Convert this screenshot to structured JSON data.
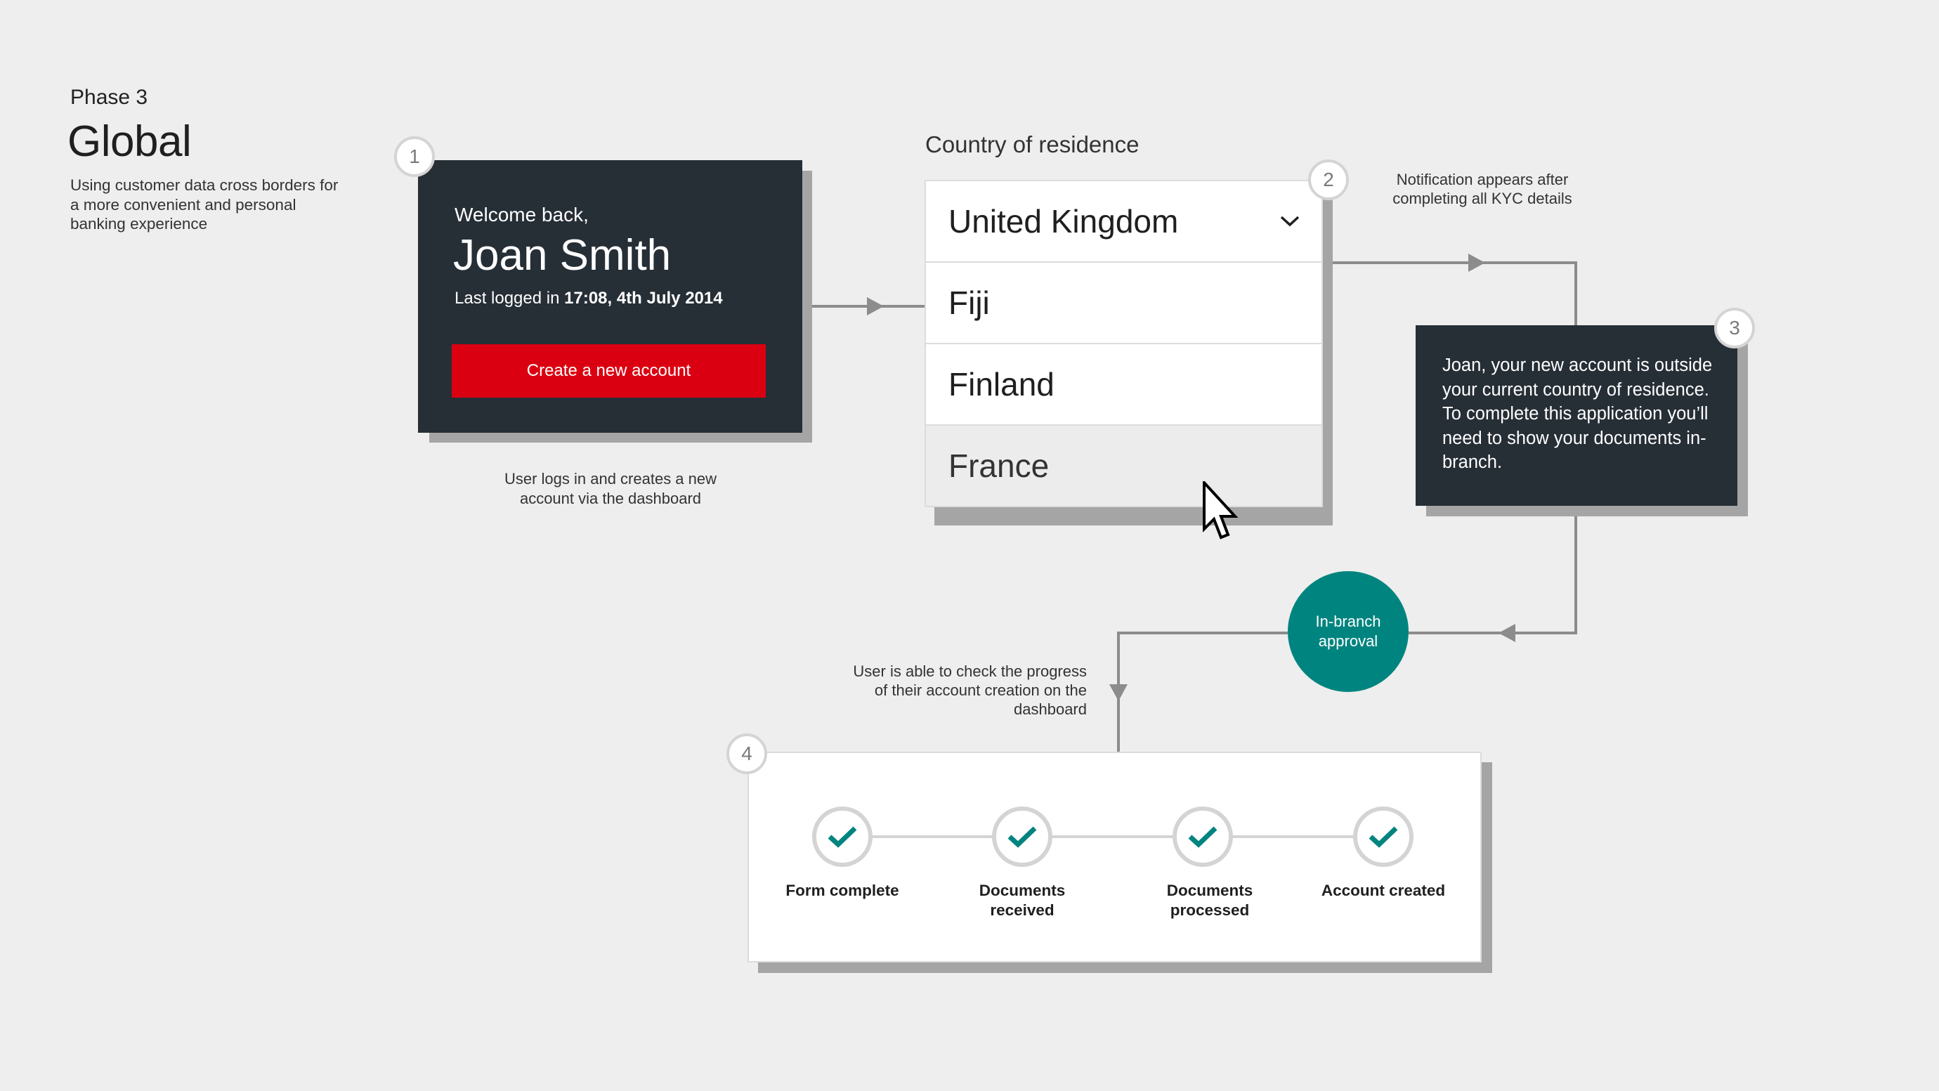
{
  "header": {
    "phase": "Phase 3",
    "title": "Global",
    "subtitle": "Using customer data cross borders for a more convenient and personal banking experience"
  },
  "steps": {
    "one": "1",
    "two": "2",
    "three": "3",
    "four": "4"
  },
  "dashboard_card": {
    "welcome": "Welcome back,",
    "name": "Joan Smith",
    "last_logged_prefix": "Last logged in",
    "last_logged_value": "17:08, 4th July 2014",
    "cta_label": "Create a new account",
    "caption": "User logs in and creates a new account via the dashboard"
  },
  "country_select": {
    "label": "Country of residence",
    "selected": "United Kingdom",
    "options": [
      "Fiji",
      "Finland",
      "France"
    ],
    "hovered_option": "France"
  },
  "notification": {
    "caption": "Notification appears after completing all KYC details",
    "message": "Joan, your new account is outside your current country of residence. To complete this application you’ll need to show your documents in-branch."
  },
  "approval": {
    "label": "In-branch approval"
  },
  "progress": {
    "caption": "User is able to check the progress of their account creation on the dashboard",
    "steps": [
      {
        "label": "Form complete"
      },
      {
        "label": "Documents received"
      },
      {
        "label": "Documents processed"
      },
      {
        "label": "Account created"
      }
    ]
  },
  "colors": {
    "dark_card": "#262e36",
    "brand_red": "#db0011",
    "teal": "#00847f",
    "background": "#eeeeee"
  }
}
